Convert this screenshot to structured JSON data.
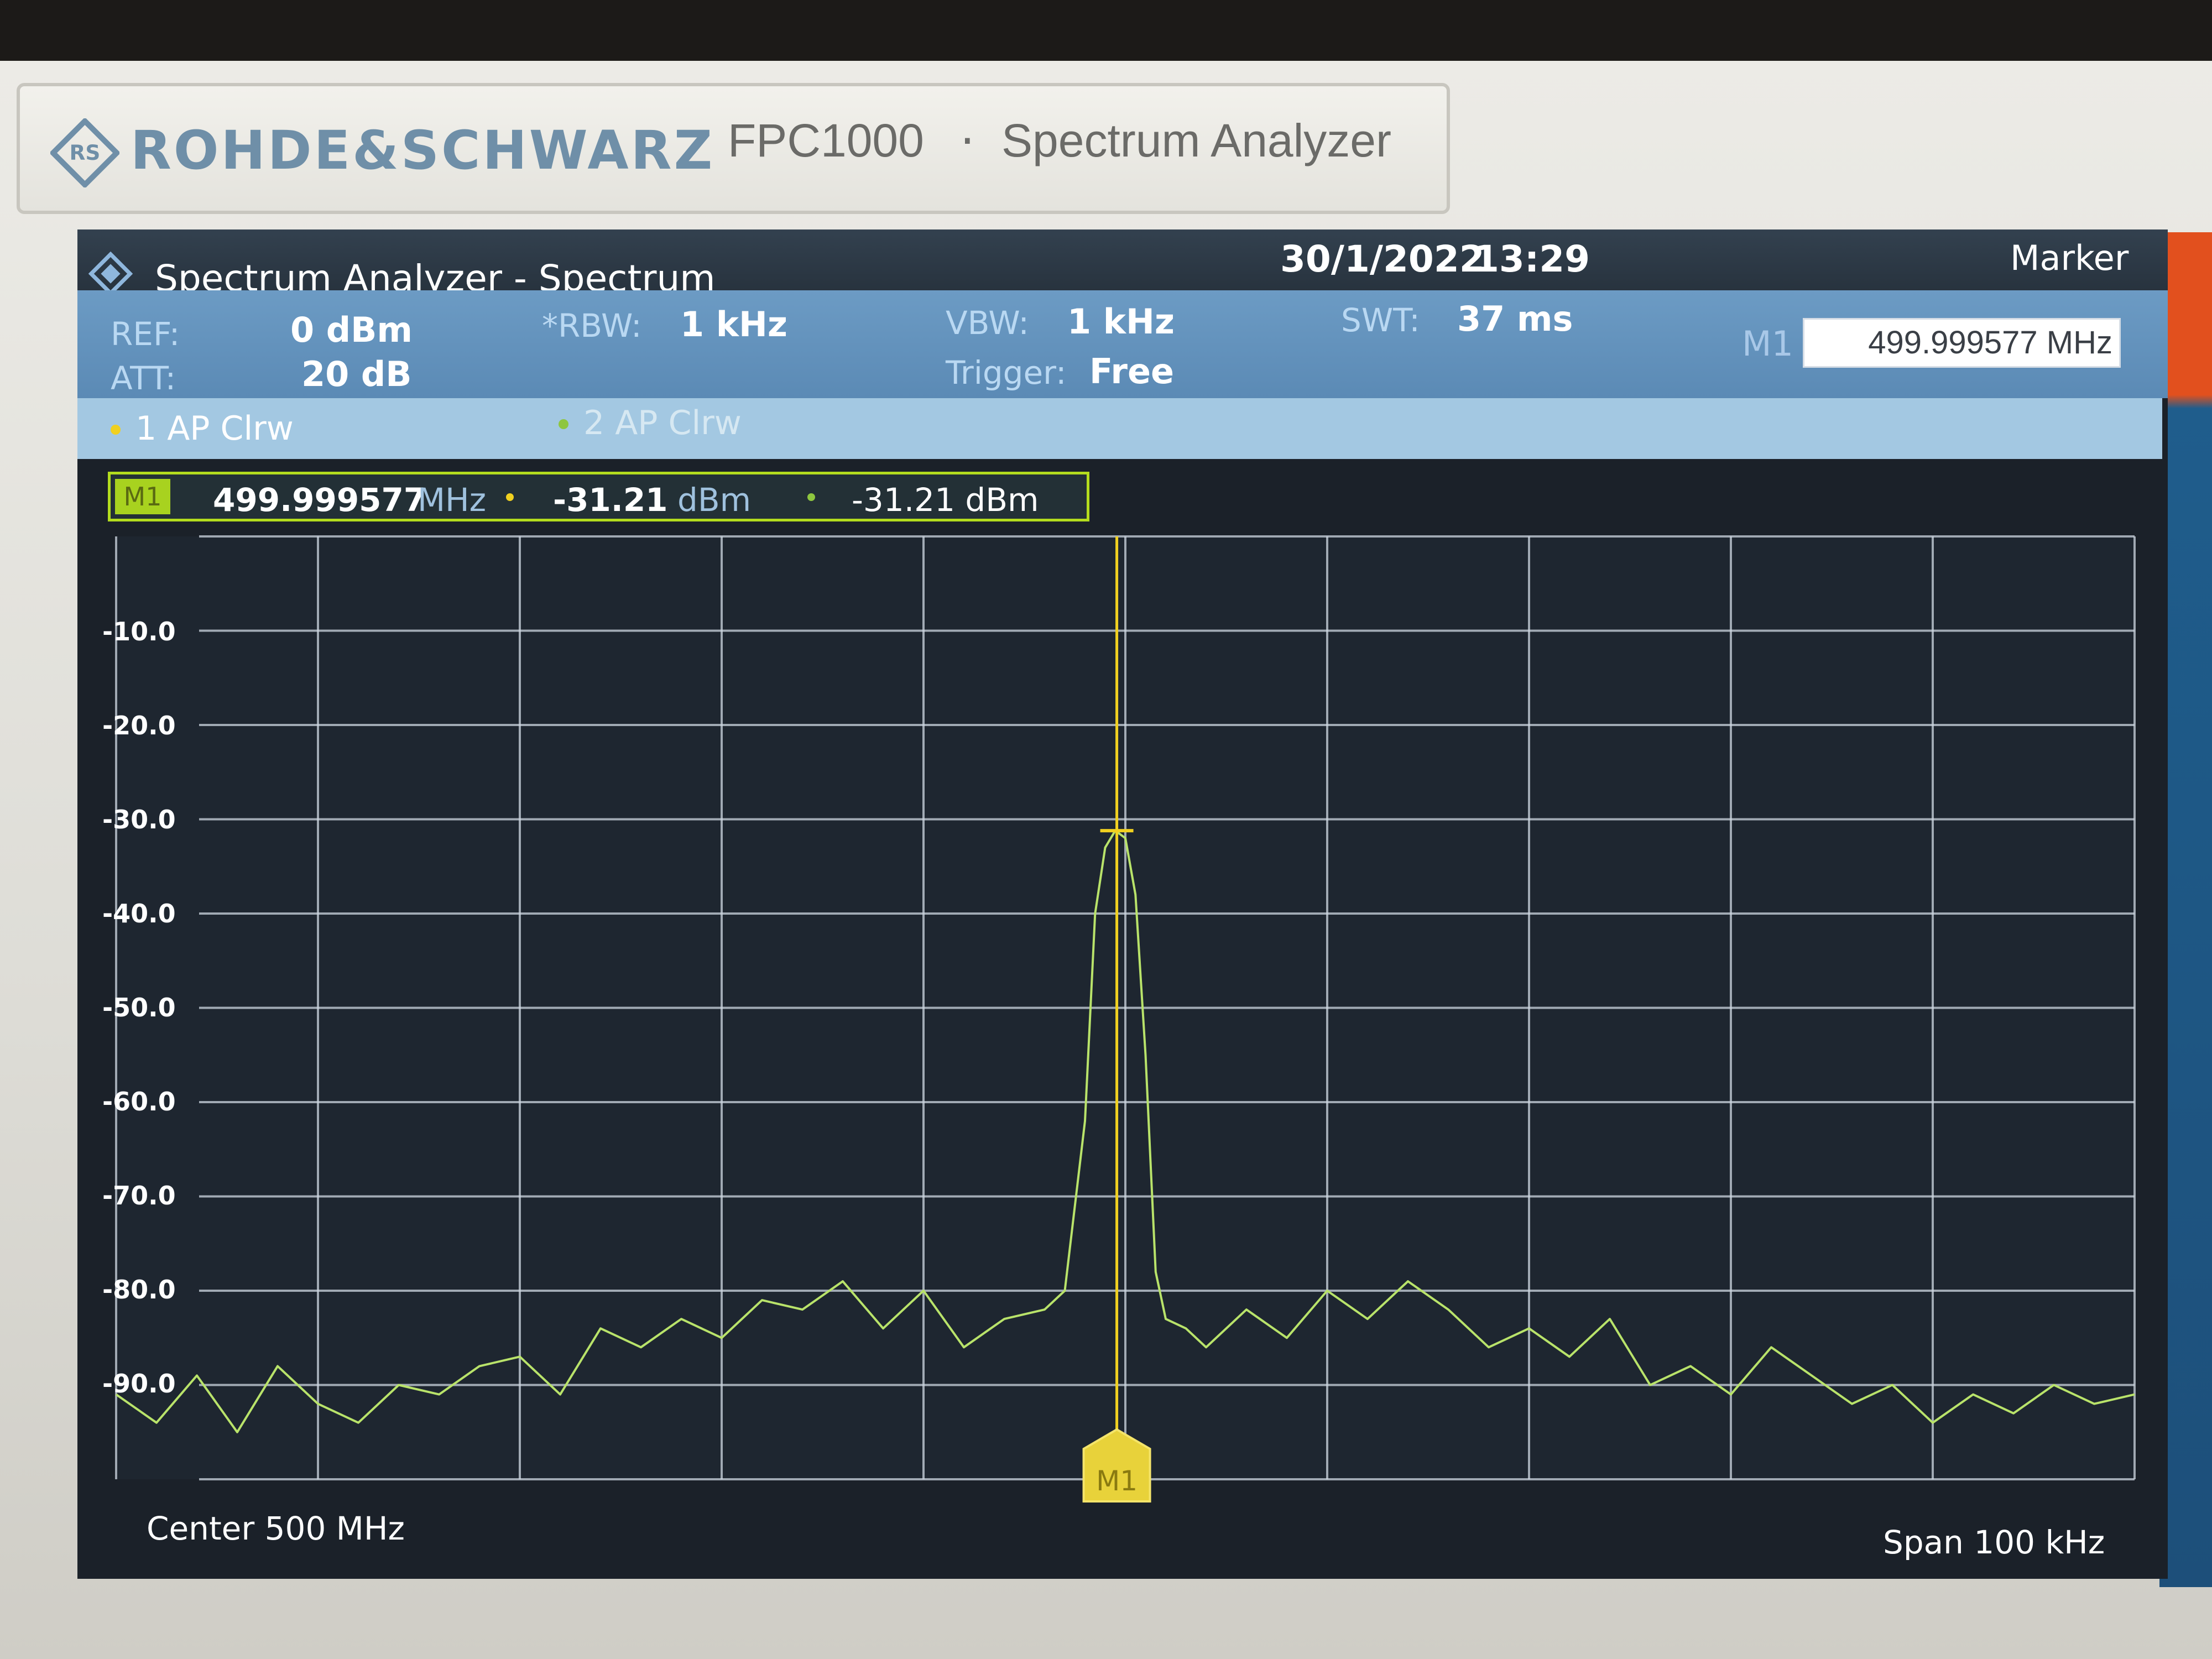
{
  "device": {
    "brand": "ROHDE&SCHWARZ",
    "model": "FPC1000",
    "separator": "·",
    "product": "Spectrum Analyzer"
  },
  "titlebar": {
    "app_title": "Spectrum Analyzer - Spectrum",
    "date": "30/1/2022",
    "time": "13:29",
    "softkey_menu": "Marker"
  },
  "params": {
    "ref_label": "REF:",
    "ref_value": "0 dBm",
    "att_label": "ATT:",
    "att_value": "20 dB",
    "rbw_label": "*RBW:",
    "rbw_value": "1 kHz",
    "vbw_label": "VBW:",
    "vbw_value": "1 kHz",
    "trigger_label": "Trigger:",
    "trigger_value": "Free",
    "swt_label": "SWT:",
    "swt_value": "37 ms"
  },
  "marker_entry": {
    "label": "M1",
    "value": "499.999577 MHz"
  },
  "traces": [
    {
      "label": "1 AP  Clrw",
      "color": "#f0d020"
    },
    {
      "label": "2 AP  Clrw",
      "color": "#8ec63f"
    }
  ],
  "marker_table": {
    "name": "M1",
    "frequency": "499.999577",
    "frequency_unit": "MHz",
    "trace1_level": "-31.21",
    "trace1_unit": "dBm",
    "trace2_level": "-31.21 dBm"
  },
  "axis": {
    "center_label": "Center 500 MHz",
    "span_label": "Span 100 kHz",
    "y_ticks": [
      "-10.0",
      "-20.0",
      "-30.0",
      "-40.0",
      "-50.0",
      "-60.0",
      "-70.0",
      "-80.0",
      "-90.0"
    ]
  },
  "colors": {
    "trace1": "#f0d020",
    "trace2": "#b9e36a",
    "grid": "#cdd6e0",
    "marker_border": "#b3dc1e",
    "brand_blue": "#6f8fa8"
  },
  "chart_data": {
    "type": "line",
    "x_unit": "kHz offset from center",
    "ylim": [
      -100,
      0
    ],
    "xlim": [
      -50,
      50
    ],
    "grid": true,
    "marker": {
      "name": "M1",
      "x": -0.423,
      "y": -31.21
    },
    "series": [
      {
        "name": "2 AP Clrw",
        "x": [
          -50,
          -48,
          -46,
          -44,
          -42,
          -40,
          -38,
          -36,
          -34,
          -32,
          -30,
          -28,
          -26,
          -24,
          -22,
          -20,
          -18,
          -16,
          -14,
          -12,
          -10,
          -8,
          -6,
          -4,
          -3,
          -2,
          -1.5,
          -1,
          -0.5,
          0,
          0.5,
          1,
          1.5,
          2,
          3,
          4,
          6,
          8,
          10,
          12,
          14,
          16,
          18,
          20,
          22,
          24,
          26,
          28,
          30,
          32,
          34,
          36,
          38,
          40,
          42,
          44,
          46,
          48,
          50
        ],
        "y": [
          -91,
          -94,
          -89,
          -95,
          -88,
          -92,
          -94,
          -90,
          -91,
          -88,
          -87,
          -91,
          -84,
          -86,
          -83,
          -85,
          -81,
          -82,
          -79,
          -84,
          -80,
          -86,
          -83,
          -82,
          -80,
          -62,
          -40,
          -33,
          -31.2,
          -32,
          -38,
          -55,
          -78,
          -83,
          -84,
          -86,
          -82,
          -85,
          -80,
          -83,
          -79,
          -82,
          -86,
          -84,
          -87,
          -83,
          -90,
          -88,
          -91,
          -86,
          -89,
          -92,
          -90,
          -94,
          -91,
          -93,
          -90,
          -92,
          -91
        ]
      }
    ]
  }
}
